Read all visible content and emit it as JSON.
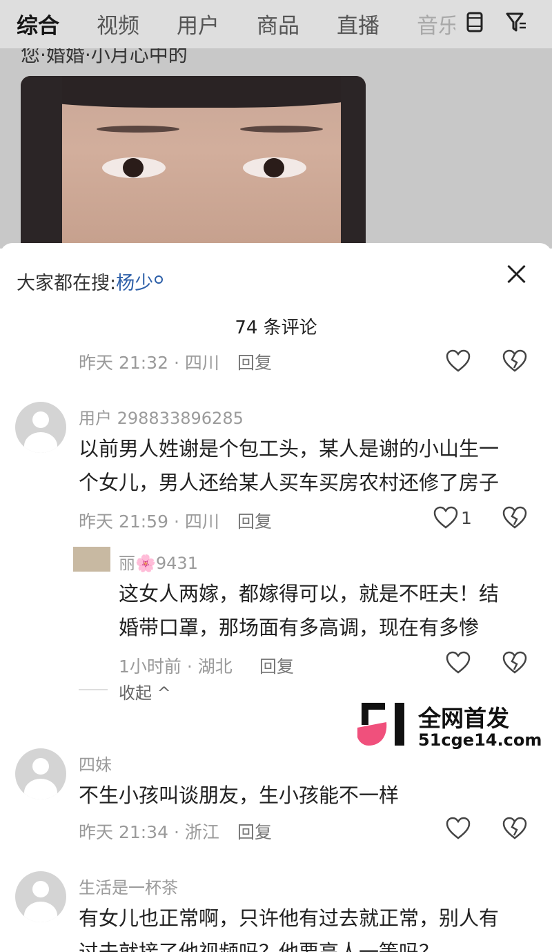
{
  "search_tabs": [
    {
      "label": "综合",
      "active": true
    },
    {
      "label": "视频",
      "active": false
    },
    {
      "label": "用户",
      "active": false
    },
    {
      "label": "商品",
      "active": false
    },
    {
      "label": "直播",
      "active": false
    },
    {
      "label": "音乐",
      "active": false
    }
  ],
  "icons": {
    "layout": "tablet-icon",
    "filter": "filter-icon"
  },
  "background": {
    "title_fragment": "您·婚婚·小月心中的"
  },
  "sheet": {
    "hot_search_label": "大家都在搜:",
    "hot_search_keyword": "杨少",
    "comment_count": "74 条评论",
    "partial_meta": "昨天 21:32 · 四川",
    "partial_reply": "回复"
  },
  "comments": [
    {
      "user": "用户 2988338962​85",
      "lines": [
        "以前男人姓谢是个包工头，某人是谢的小山生一",
        "个女儿，男人还给某人买车买房农村还修了房子"
      ],
      "meta": "昨天 21:59 · 四川",
      "reply": "回复",
      "likes": "1"
    },
    {
      "user": "丽🌸9431",
      "lines": [
        "这女人两嫁，都嫁得可以，就是不旺夫！结",
        "婚带口罩，那场面有多高调，现在有多惨"
      ],
      "meta": "1小时前 · 湖北",
      "reply": "回复",
      "likes": ""
    },
    {
      "user": "四妹",
      "lines": [
        "不生小孩叫谈朋友，生小孩能不一样"
      ],
      "meta": "昨天 21:34 · 浙江",
      "reply": "回复",
      "likes": ""
    },
    {
      "user": "生活是一杯茶",
      "lines": [
        "有女儿也正常啊，只许他有过去就正常，别人有",
        "过去就接了他视频吗？他要高人一等吗？"
      ],
      "meta": "",
      "reply": "",
      "likes": ""
    }
  ],
  "collapse_label": "收起 ^",
  "watermark": {
    "line1": "全网首发",
    "line2": "51cge14.com"
  },
  "colors": {
    "accent_keyword": "#2d5fa8",
    "watermark_pink": "#f0507c"
  }
}
